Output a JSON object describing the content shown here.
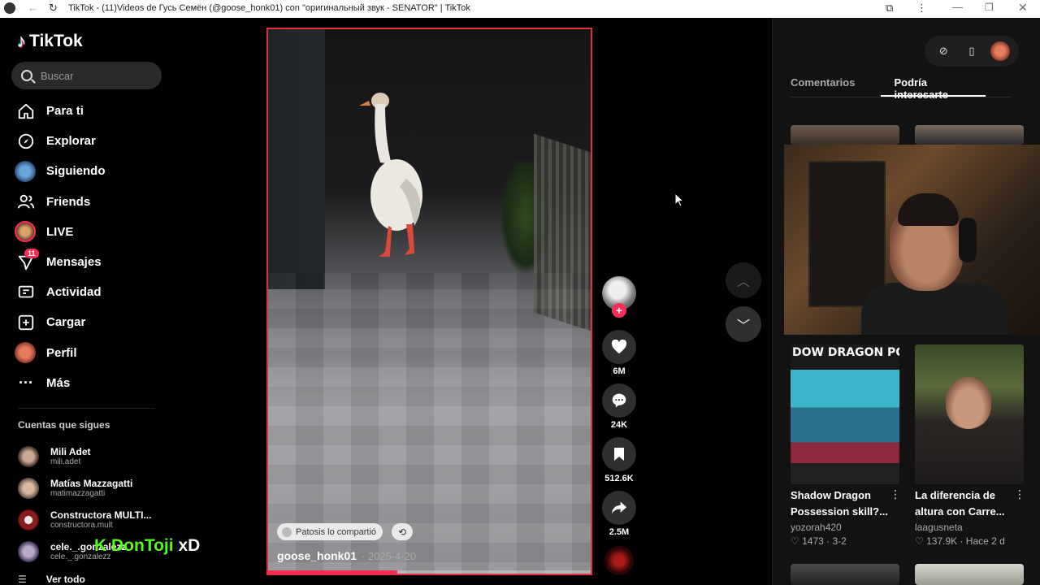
{
  "browser": {
    "title": "TikTok - (11)Videos de Гусь Семён (@goose_honk01) con \"оригинальный звук - SENATOR\" | TikTok",
    "icons": {
      "back": "arrow-left-icon",
      "reload": "reload-icon",
      "extensions": "puzzle-icon",
      "menu": "kebab-menu-icon",
      "minimize": "minimize-icon",
      "maximize": "maximize-icon",
      "close": "close-icon"
    }
  },
  "sidebar": {
    "logo": "TikTok",
    "search_placeholder": "Buscar",
    "nav": [
      {
        "label": "Para ti",
        "icon": "home-icon"
      },
      {
        "label": "Explorar",
        "icon": "compass-icon"
      },
      {
        "label": "Siguiendo",
        "icon": "avatar"
      },
      {
        "label": "Friends",
        "icon": "friends-icon"
      },
      {
        "label": "LIVE",
        "icon": "live-avatar"
      },
      {
        "label": "Mensajes",
        "icon": "send-icon",
        "badge": "11"
      },
      {
        "label": "Actividad",
        "icon": "inbox-icon"
      },
      {
        "label": "Cargar",
        "icon": "plus-square-icon"
      },
      {
        "label": "Perfil",
        "icon": "profile-avatar"
      },
      {
        "label": "Más",
        "icon": "more-dots-icon"
      }
    ],
    "following_title": "Cuentas que sigues",
    "accounts": [
      {
        "name": "Mili Adet",
        "username": "mili.adet"
      },
      {
        "name": "Matías Mazzagatti",
        "username": "matimazzagatti"
      },
      {
        "name": "Constructora MULTI...",
        "username": "constructora.mult"
      },
      {
        "name": "cele._.gonzalezz",
        "username": "cele._.gonzalezz"
      }
    ],
    "see_all": "Ver todo"
  },
  "overlay": {
    "brand": "DonToji",
    "suffix": "xD"
  },
  "video": {
    "shared_by": "Patosis lo compartió",
    "author": "goose_honk01",
    "date": "· 2025-4-20",
    "progress": 0.4
  },
  "actions": {
    "likes": "6M",
    "comments": "24K",
    "saves": "512.6K",
    "shares": "2.5M"
  },
  "right_panel": {
    "tabs": [
      {
        "label": "Comentarios",
        "active": false
      },
      {
        "label": "Podría interesarte",
        "active": true
      }
    ],
    "cards": [
      {
        "title": "Shadow Dragon Possession skill?...",
        "thumb_text": "DOW DRAGON POSSESS",
        "author": "yozorah420",
        "likes": "♡ 1473",
        "time": "· 3-2"
      },
      {
        "title": "La diferencia de altura con Carre...",
        "author": "laagusneta",
        "likes": "♡ 137.9K",
        "time": "· Hace 2 d"
      }
    ]
  }
}
